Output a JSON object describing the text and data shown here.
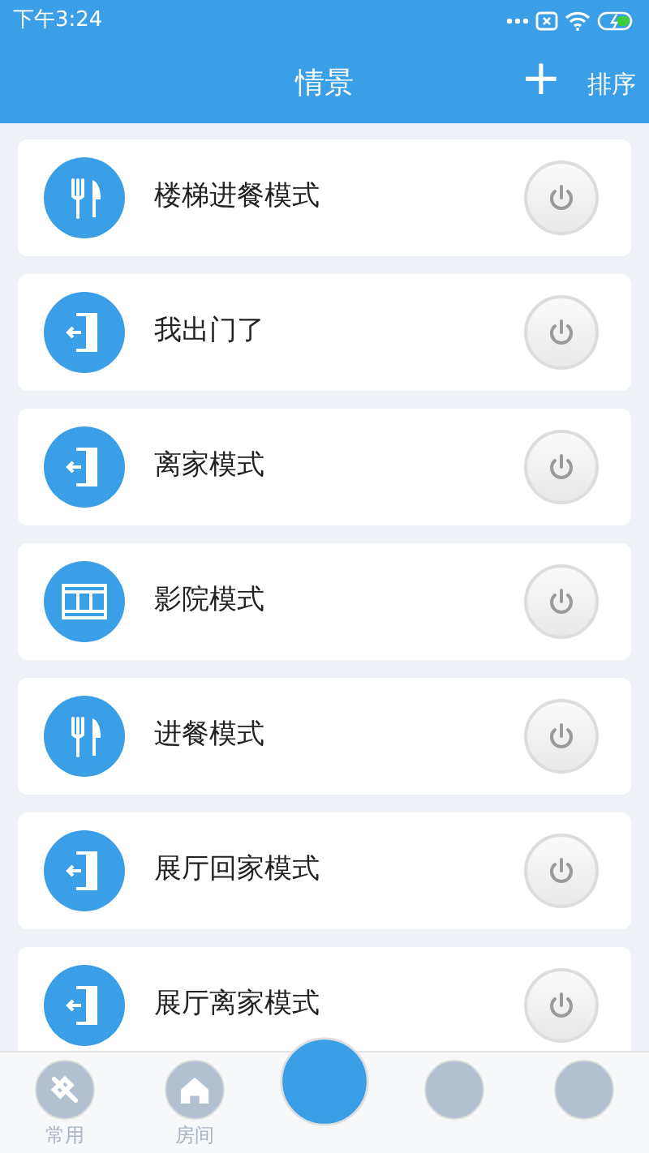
{
  "status_bar": {
    "time": "下午3:24"
  },
  "header": {
    "title": "情景",
    "add_icon": "+",
    "sort": "排序"
  },
  "scenes": [
    {
      "name": "楼梯进餐模式",
      "kind": "dining",
      "on": false
    },
    {
      "name": "我出门了",
      "kind": "exit",
      "on": false
    },
    {
      "name": "离家模式",
      "kind": "exit",
      "on": false
    },
    {
      "name": "影院模式",
      "kind": "film",
      "on": false
    },
    {
      "name": "进餐模式",
      "kind": "dining",
      "on": false
    },
    {
      "name": "展厅回家模式",
      "kind": "exit",
      "on": false
    },
    {
      "name": "展厅离家模式",
      "kind": "exit",
      "on": false
    }
  ],
  "bottom_nav": [
    {
      "label": "常用",
      "kind": "pin",
      "selected": false
    },
    {
      "label": "房间",
      "kind": "home",
      "selected": false
    },
    {
      "kind": "center",
      "selected": true
    },
    {
      "kind": "round",
      "selected": false
    },
    {
      "kind": "round",
      "selected": false
    }
  ]
}
